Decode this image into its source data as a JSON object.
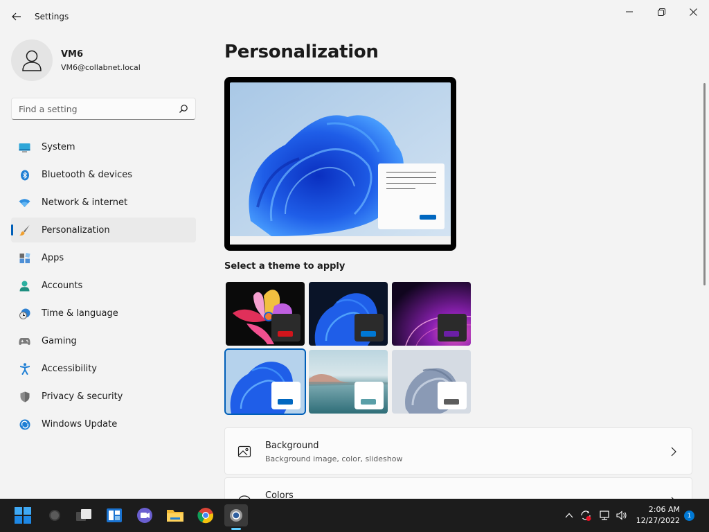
{
  "window": {
    "title": "Settings"
  },
  "profile": {
    "name": "VM6",
    "email": "VM6@collabnet.local"
  },
  "search": {
    "placeholder": "Find a setting"
  },
  "nav": {
    "items": [
      {
        "label": "System",
        "icon": "monitor-icon",
        "selected": false
      },
      {
        "label": "Bluetooth & devices",
        "icon": "bluetooth-icon",
        "selected": false
      },
      {
        "label": "Network & internet",
        "icon": "wifi-icon",
        "selected": false
      },
      {
        "label": "Personalization",
        "icon": "paintbrush-icon",
        "selected": true
      },
      {
        "label": "Apps",
        "icon": "apps-icon",
        "selected": false
      },
      {
        "label": "Accounts",
        "icon": "person-icon",
        "selected": false
      },
      {
        "label": "Time & language",
        "icon": "globe-clock-icon",
        "selected": false
      },
      {
        "label": "Gaming",
        "icon": "gamepad-icon",
        "selected": false
      },
      {
        "label": "Accessibility",
        "icon": "accessibility-icon",
        "selected": false
      },
      {
        "label": "Privacy & security",
        "icon": "shield-icon",
        "selected": false
      },
      {
        "label": "Windows Update",
        "icon": "update-icon",
        "selected": false
      }
    ]
  },
  "main": {
    "title": "Personalization",
    "themes_heading": "Select a theme to apply",
    "themes": [
      {
        "name": "glow",
        "swatch": "#d0151c",
        "card": "#2b2b2b",
        "selected": false
      },
      {
        "name": "windows-dark",
        "swatch": "#0078d4",
        "card": "#2b2b2b",
        "selected": false
      },
      {
        "name": "captured-motion",
        "swatch": "#6b1fa6",
        "card": "#2b2b2b",
        "selected": false
      },
      {
        "name": "windows-light",
        "swatch": "#0067c0",
        "card": "#ffffff",
        "selected": true
      },
      {
        "name": "sunrise",
        "swatch": "#5a9fa8",
        "card": "#ffffff",
        "selected": false
      },
      {
        "name": "flow",
        "swatch": "#5d5d5d",
        "card": "#ffffff",
        "selected": false
      }
    ],
    "cards": [
      {
        "title": "Background",
        "subtitle": "Background image, color, slideshow",
        "icon": "image-icon"
      },
      {
        "title": "Colors",
        "subtitle": "",
        "icon": "palette-icon"
      }
    ]
  },
  "taskbar": {
    "clock_time": "2:06 AM",
    "clock_date": "12/27/2022",
    "notification_count": "1"
  },
  "colors": {
    "accent": "#005fb8",
    "background": "#f3f3f3",
    "taskbar": "#1c1c1c"
  }
}
